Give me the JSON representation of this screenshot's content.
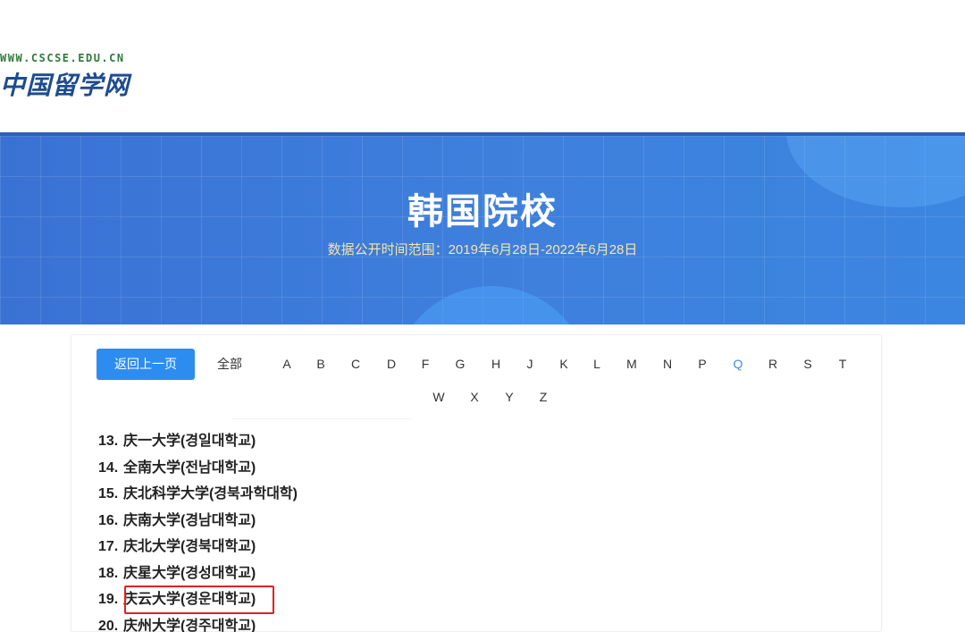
{
  "logo": {
    "url": "WWW.CSCSE.EDU.CN",
    "name": "中国留学网"
  },
  "banner": {
    "title": "韩国院校",
    "subtitle": "数据公开时间范围：2019年6月28日-2022年6月28日"
  },
  "nav": {
    "back_label": "返回上一页",
    "all_label": "全部",
    "letters": [
      "A",
      "B",
      "C",
      "D",
      "F",
      "G",
      "H",
      "J",
      "K",
      "L",
      "M",
      "N",
      "P",
      "Q",
      "R",
      "S",
      "T",
      "W",
      "X",
      "Y",
      "Z"
    ],
    "active_letter": "Q"
  },
  "schools": [
    {
      "num": "13.",
      "name": "庆一大学(경일대학교)"
    },
    {
      "num": "14.",
      "name": "全南大学(전남대학교)"
    },
    {
      "num": "15.",
      "name": "庆北科学大学(경북과학대학)"
    },
    {
      "num": "16.",
      "name": "庆南大学(경남대학교)"
    },
    {
      "num": "17.",
      "name": "庆北大学(경북대학교)"
    },
    {
      "num": "18.",
      "name": "庆星大学(경성대학교)"
    },
    {
      "num": "19.",
      "name": "庆云大学(경운대학교)"
    },
    {
      "num": "20.",
      "name": "庆州大学(경주대학교)"
    }
  ],
  "colors": {
    "banner_bg": "#3e7fdc",
    "accent": "#2d8cf0",
    "active_letter": "#3a8ee6",
    "highlight": "#e02020"
  }
}
